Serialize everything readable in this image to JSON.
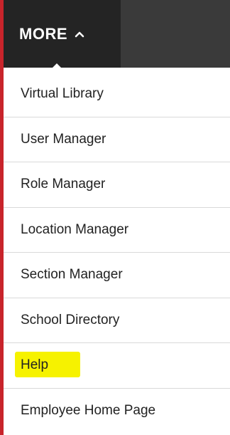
{
  "menu": {
    "toggle_label": "MORE",
    "items": [
      {
        "label": "Virtual Library"
      },
      {
        "label": "User Manager"
      },
      {
        "label": "Role Manager"
      },
      {
        "label": "Location Manager"
      },
      {
        "label": "Section Manager"
      },
      {
        "label": "School Directory"
      },
      {
        "label": "Help",
        "highlighted": true
      },
      {
        "label": "Employee Home Page"
      }
    ]
  },
  "colors": {
    "accent_border": "#c8242b",
    "topbar": "#3a3a3a",
    "active_tab": "#242424",
    "highlight": "#f6f200"
  },
  "icons": {
    "toggle_caret": "chevron-up-icon"
  }
}
